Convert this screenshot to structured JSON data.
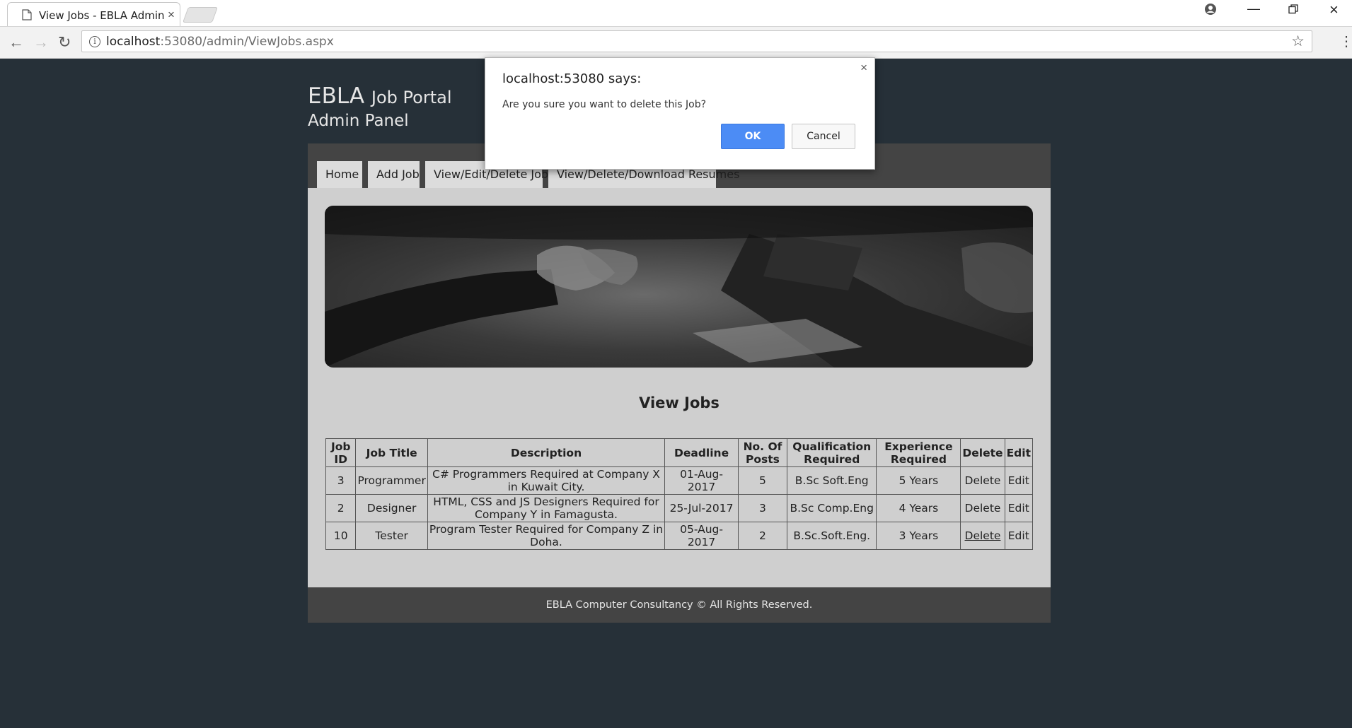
{
  "browser": {
    "tab_title": "View Jobs - EBLA Admin",
    "url_host": "localhost",
    "url_rest": ":53080/admin/ViewJobs.aspx"
  },
  "site": {
    "brand_main": "EBLA",
    "brand_sub": "Job Portal",
    "panel_title": "Admin Panel"
  },
  "nav": {
    "items": [
      {
        "label": "Home"
      },
      {
        "label": "Add Job"
      },
      {
        "label": "View/Edit/Delete Jobs"
      },
      {
        "label": "View/Delete/Download Resumes"
      }
    ]
  },
  "main": {
    "section_title": "View Jobs",
    "table": {
      "headers": [
        "Job ID",
        "Job Title",
        "Description",
        "Deadline",
        "No. Of Posts",
        "Qualification Required",
        "Experience Required",
        "Delete",
        "Edit"
      ],
      "rows": [
        [
          "3",
          "Programmer",
          "C# Programmers Required at Company X in Kuwait City.",
          "01-Aug-2017",
          "5",
          "B.Sc Soft.Eng",
          "5 Years",
          "Delete",
          "Edit"
        ],
        [
          "2",
          "Designer",
          "HTML, CSS and JS Designers Required for Company Y in Famagusta.",
          "25-Jul-2017",
          "3",
          "B.Sc Comp.Eng",
          "4 Years",
          "Delete",
          "Edit"
        ],
        [
          "10",
          "Tester",
          "Program Tester Required for Company Z in Doha.",
          "05-Aug-2017",
          "2",
          "B.Sc.Soft.Eng.",
          "3 Years",
          "Delete",
          "Edit"
        ]
      ]
    }
  },
  "footer": {
    "text": "EBLA Computer Consultancy © All Rights Reserved."
  },
  "dialog": {
    "title": "localhost:53080 says:",
    "message": "Are you sure you want to delete this Job?",
    "ok_label": "OK",
    "cancel_label": "Cancel"
  },
  "colors": {
    "page_bg": "#263038",
    "nav_bg": "#444444",
    "content_bg": "#cfcfcf",
    "ok_button": "#4c8cf5"
  },
  "icons": [
    "page-icon",
    "close-icon",
    "account-icon",
    "minimize-icon",
    "restore-icon",
    "back-icon",
    "forward-icon",
    "reload-icon",
    "info-icon",
    "star-icon",
    "menu-icon"
  ]
}
